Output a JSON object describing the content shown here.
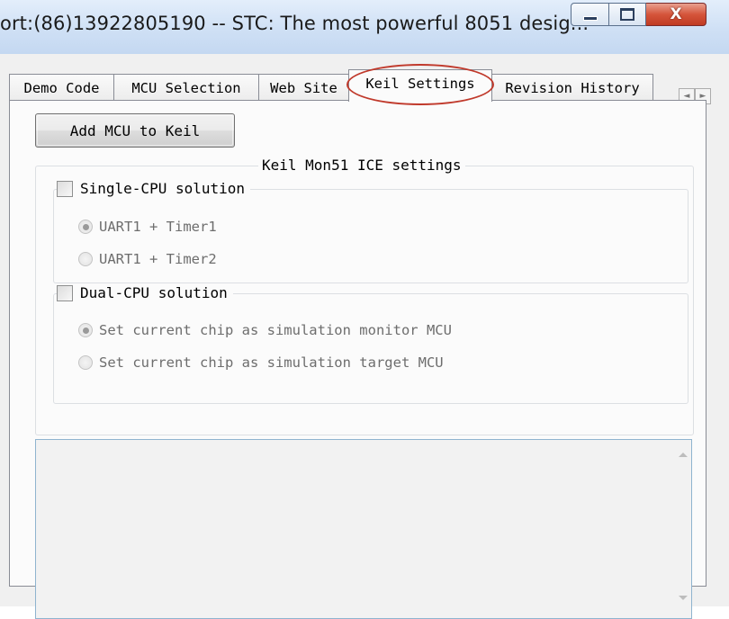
{
  "window": {
    "title": "ort:(86)13922805190  -- STC: The most powerful 8051 desig...",
    "close_glyph": "X",
    "icons": [
      "minimize-icon",
      "maximize-icon",
      "close-icon"
    ]
  },
  "tabs": [
    {
      "label": "Demo Code",
      "active": false
    },
    {
      "label": "MCU Selection",
      "active": false
    },
    {
      "label": "Web Site",
      "active": false
    },
    {
      "label": "Keil Settings",
      "active": true
    },
    {
      "label": "Revision History",
      "active": false
    }
  ],
  "tab_scroll": {
    "left": "◄",
    "right": "►"
  },
  "keil": {
    "add_button": "Add MCU to Keil",
    "group_title": "Keil Mon51 ICE settings",
    "single_cpu": {
      "label": "Single-CPU solution",
      "checked": false,
      "options": [
        {
          "label": "UART1 + Timer1",
          "selected": true
        },
        {
          "label": "UART1 + Timer2",
          "selected": false
        }
      ]
    },
    "dual_cpu": {
      "label": "Dual-CPU solution",
      "checked": false,
      "options": [
        {
          "label": "Set current chip as simulation monitor MCU",
          "selected": true
        },
        {
          "label": "Set current chip as simulation target MCU",
          "selected": false
        }
      ]
    },
    "memo_text": ""
  },
  "colors": {
    "highlight_oval": "#c0392b",
    "close_button": "#c03a22",
    "titlebar": "#cfe0f5"
  }
}
